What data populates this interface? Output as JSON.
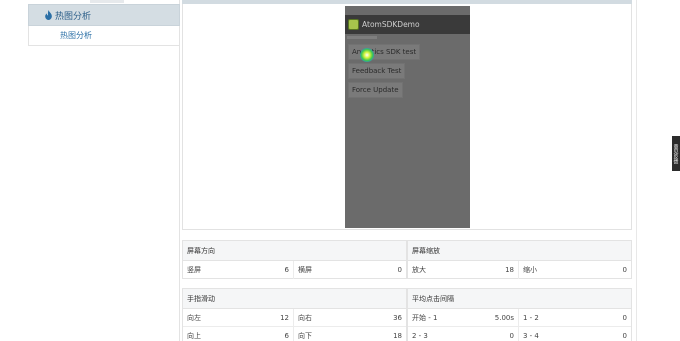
{
  "sidebar": {
    "header_label": "热图分析",
    "sub_item_label": "热图分析"
  },
  "phone": {
    "app_title": "AtomSDKDemo",
    "buttons": [
      "Analytics SDK test",
      "Feedback Test",
      "Force Update"
    ]
  },
  "stats": {
    "orientation": {
      "title": "屏幕方向",
      "rows": [
        [
          {
            "label": "竖屏",
            "value": "6"
          },
          {
            "label": "横屏",
            "value": "0"
          }
        ]
      ]
    },
    "zoom": {
      "title": "屏幕缩放",
      "rows": [
        [
          {
            "label": "放大",
            "value": "18"
          },
          {
            "label": "缩小",
            "value": "0"
          }
        ]
      ]
    },
    "swipe": {
      "title": "手指滑动",
      "rows": [
        [
          {
            "label": "向左",
            "value": "12"
          },
          {
            "label": "向右",
            "value": "36"
          }
        ],
        [
          {
            "label": "向上",
            "value": "6"
          },
          {
            "label": "向下",
            "value": "18"
          }
        ]
      ]
    },
    "click_interval": {
      "title": "平均点击间隔",
      "rows": [
        [
          {
            "label": "开始 - 1",
            "value": "5.00s"
          },
          {
            "label": "1 - 2",
            "value": "0"
          }
        ],
        [
          {
            "label": "2 - 3",
            "value": "0"
          },
          {
            "label": "3 - 4",
            "value": "0"
          }
        ]
      ]
    }
  },
  "feedback_label": "意见反馈"
}
